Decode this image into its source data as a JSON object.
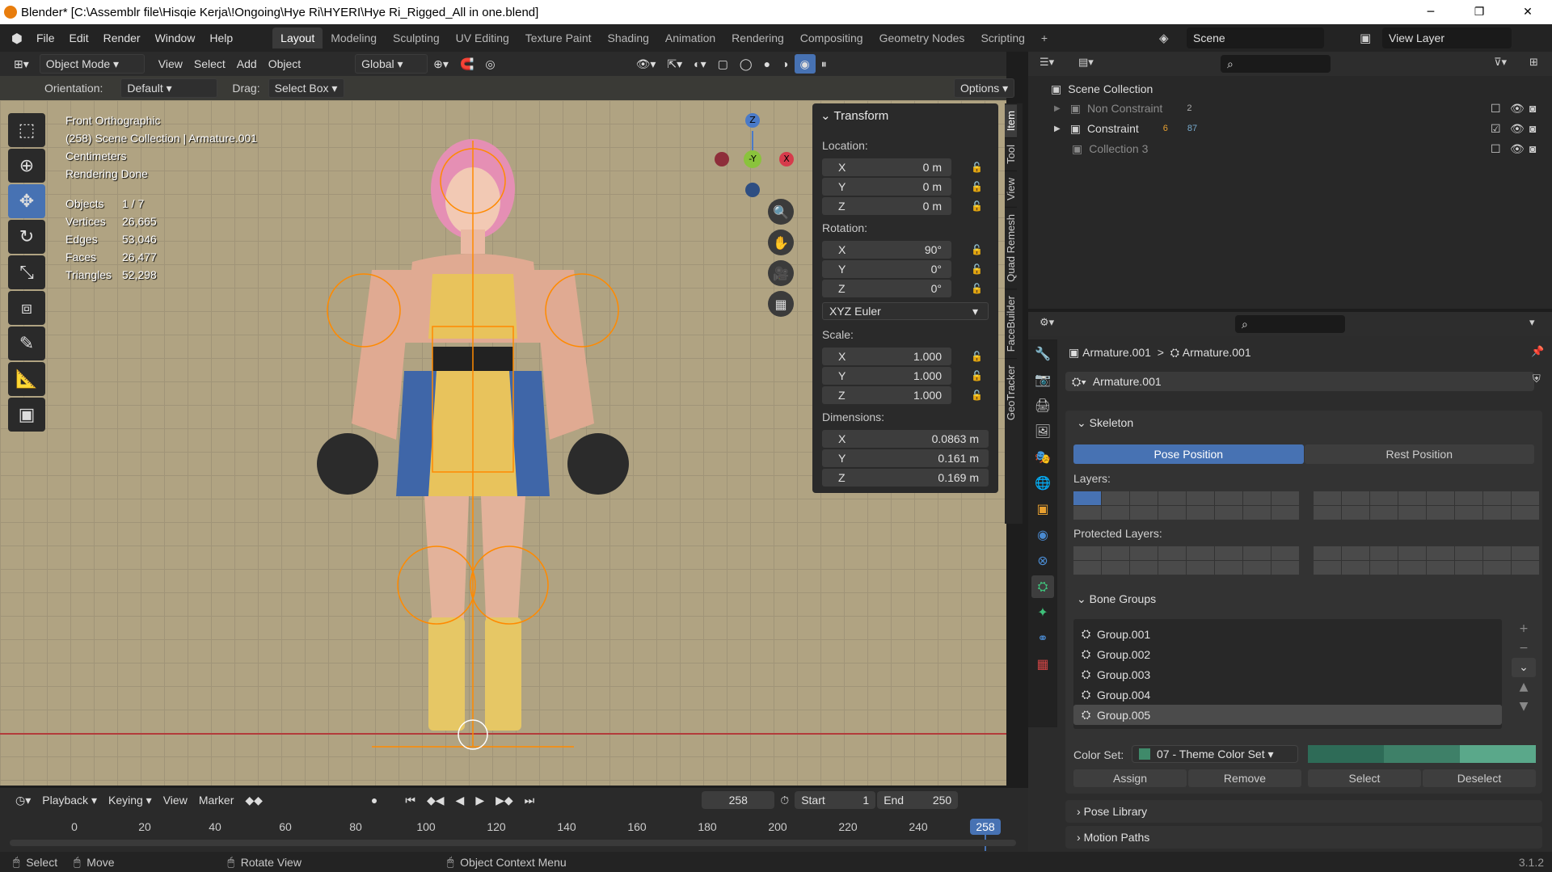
{
  "window": {
    "title": "Blender* [C:\\Assemblr file\\Hisqie Kerja\\!Ongoing\\Hye Ri\\HYERI\\Hye Ri_Rigged_All in one.blend]",
    "min": "─",
    "max": "❐",
    "close": "✕"
  },
  "menus": [
    "File",
    "Edit",
    "Render",
    "Window",
    "Help"
  ],
  "workspaces": [
    "Layout",
    "Modeling",
    "Sculpting",
    "UV Editing",
    "Texture Paint",
    "Shading",
    "Animation",
    "Rendering",
    "Compositing",
    "Geometry Nodes",
    "Scripting"
  ],
  "workspace_add": "+",
  "scene": {
    "name": "Scene",
    "view_layer": "View Layer"
  },
  "viewport_header": {
    "mode": "Object Mode",
    "menus": [
      "View",
      "Select",
      "Add",
      "Object"
    ],
    "transform": "Global"
  },
  "tool_settings": {
    "orientation_label": "Orientation:",
    "orientation_value": "Default",
    "drag_label": "Drag:",
    "drag_value": "Select Box",
    "options": "Options"
  },
  "overlay": {
    "view_name": "Front Orthographic",
    "context": "(258) Scene Collection | Armature.001",
    "units": "Centimeters",
    "status": "Rendering Done",
    "stats": [
      {
        "k": "Objects",
        "v": "1 / 7"
      },
      {
        "k": "Vertices",
        "v": "26,665"
      },
      {
        "k": "Edges",
        "v": "53,046"
      },
      {
        "k": "Faces",
        "v": "26,477"
      },
      {
        "k": "Triangles",
        "v": "52,298"
      }
    ]
  },
  "gizmo": {
    "z": "Z",
    "y": "-Y",
    "x": "X"
  },
  "npanel": {
    "title": "Transform",
    "location_label": "Location:",
    "rotation_label": "Rotation:",
    "scale_label": "Scale:",
    "dimensions_label": "Dimensions:",
    "location": [
      {
        "a": "X",
        "v": "0 m"
      },
      {
        "a": "Y",
        "v": "0 m"
      },
      {
        "a": "Z",
        "v": "0 m"
      }
    ],
    "rotation": [
      {
        "a": "X",
        "v": "90°"
      },
      {
        "a": "Y",
        "v": "0°"
      },
      {
        "a": "Z",
        "v": "0°"
      }
    ],
    "rotation_mode": "XYZ Euler",
    "scale": [
      {
        "a": "X",
        "v": "1.000"
      },
      {
        "a": "Y",
        "v": "1.000"
      },
      {
        "a": "Z",
        "v": "1.000"
      }
    ],
    "dimensions": [
      {
        "a": "X",
        "v": "0.0863 m"
      },
      {
        "a": "Y",
        "v": "0.161 m"
      },
      {
        "a": "Z",
        "v": "0.169 m"
      }
    ]
  },
  "side_tabs": [
    "Item",
    "Tool",
    "View",
    "Quad Remesh",
    "FaceBuilder",
    "GeoTracker"
  ],
  "outliner": {
    "root": "Scene Collection",
    "items": [
      {
        "name": "Non Constraint",
        "badge": "2"
      },
      {
        "name": "Constraint",
        "badge": "6",
        "badge2": "87"
      },
      {
        "name": "Collection 3"
      }
    ]
  },
  "properties": {
    "breadcrumb_a": "Armature.001",
    "breadcrumb_sep": ">",
    "breadcrumb_b": "Armature.001",
    "data_name": "Armature.001",
    "skeleton": "Skeleton",
    "pose_position": "Pose Position",
    "rest_position": "Rest Position",
    "layers": "Layers:",
    "protected_layers": "Protected Layers:",
    "bone_groups": "Bone Groups",
    "groups": [
      "Group.001",
      "Group.002",
      "Group.003",
      "Group.004",
      "Group.005"
    ],
    "color_set_label": "Color Set:",
    "color_set_value": "07 - Theme Color Set",
    "assign": "Assign",
    "remove": "Remove",
    "select": "Select",
    "deselect": "Deselect",
    "pose_library": "Pose Library",
    "motion_paths": "Motion Paths"
  },
  "timeline": {
    "playback": "Playback",
    "keying": "Keying",
    "view": "View",
    "marker": "Marker",
    "current_frame": "258",
    "start_label": "Start",
    "start": "1",
    "end_label": "End",
    "end": "250",
    "ticks": [
      "0",
      "20",
      "40",
      "60",
      "80",
      "100",
      "120",
      "140",
      "160",
      "180",
      "200",
      "220",
      "240"
    ],
    "playhead": "258"
  },
  "status": {
    "select": "Select",
    "move": "Move",
    "rotate": "Rotate View",
    "context": "Object Context Menu",
    "version": "3.1.2"
  },
  "colors": {
    "accent": "#4772b3",
    "viewport_bg": "#b0a382",
    "bone": "#ff8a00"
  }
}
